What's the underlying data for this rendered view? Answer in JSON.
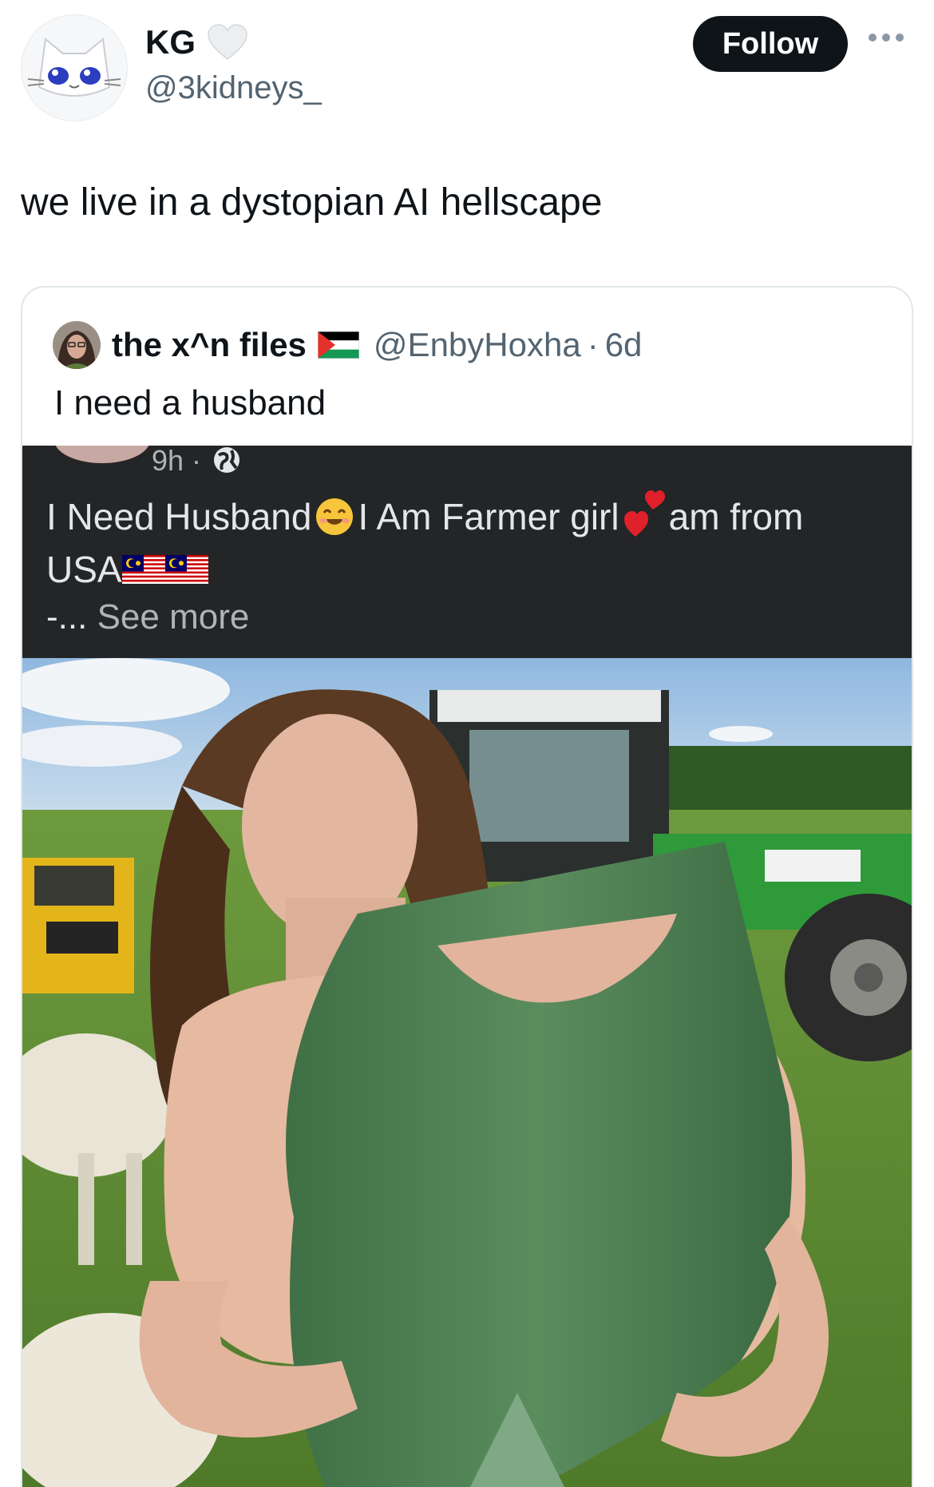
{
  "author": {
    "display_name": "KG",
    "handle": "@3kidneys_",
    "avatar": "white-cat-face-avatar",
    "badge_icon": "white-heart-icon"
  },
  "follow_button": {
    "label": "Follow"
  },
  "more_menu": {
    "icon": "more-horizontal-icon"
  },
  "tweet": {
    "text": "we live in a dystopian AI hellscape"
  },
  "quoted_post": {
    "display_name": "the x^n files",
    "name_flag": "palestine-flag-icon",
    "handle": "@EnbyHoxha",
    "separator": "·",
    "time": "6d",
    "text": "I need a husband",
    "embedded_screenshot": {
      "time": "9h ·",
      "line1_a": "I Need Husband",
      "line1_b": "I Am Farmer girl",
      "line1_c": "am from",
      "line2": "USA",
      "ellipsis": "-...",
      "see_more": "See more"
    },
    "photo": "woman-in-green-tank-top-by-tractors-and-sheep-photo"
  },
  "colors": {
    "text_primary": "#0f1419",
    "text_secondary": "#536471",
    "follow_bg": "#0f1419",
    "card_border": "#e1e6ea",
    "fb_panel_bg": "#242526"
  }
}
